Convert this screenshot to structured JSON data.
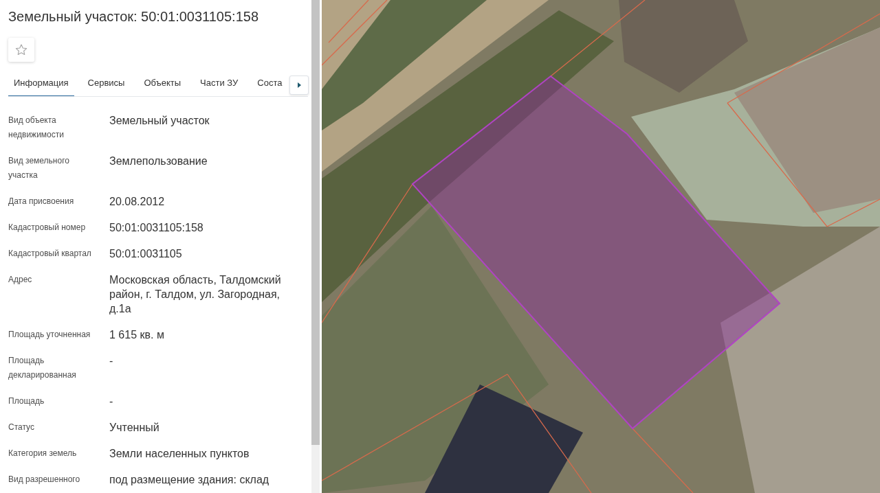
{
  "title": "Земельный участок: 50:01:0031105:158",
  "tabs": [
    {
      "label": "Информация",
      "selected": true
    },
    {
      "label": "Сервисы",
      "selected": false
    },
    {
      "label": "Объекты",
      "selected": false
    },
    {
      "label": "Части ЗУ",
      "selected": false
    },
    {
      "label": "Соста",
      "selected": false
    }
  ],
  "properties": [
    {
      "label": "Вид объекта недвижимости",
      "value": "Земельный участок"
    },
    {
      "label": "Вид земельного участка",
      "value": "Землепользование"
    },
    {
      "label": "Дата присвоения",
      "value": "20.08.2012"
    },
    {
      "label": "Кадастровый номер",
      "value": "50:01:0031105:158"
    },
    {
      "label": "Кадастровый квартал",
      "value": "50:01:0031105"
    },
    {
      "label": "Адрес",
      "value": "Московская область, Талдомский район, г. Талдом, ул. Загородная, д.1а"
    },
    {
      "label": "Площадь уточненная",
      "value": "1 615 кв. м"
    },
    {
      "label": "Площадь декларированная",
      "value": "-"
    },
    {
      "label": "Площадь",
      "value": "-"
    },
    {
      "label": "Статус",
      "value": "Учтенный"
    },
    {
      "label": "Категория земель",
      "value": "Земли населенных пунктов"
    },
    {
      "label": "Вид разрешенного",
      "value": "под размещение здания: склад"
    }
  ]
}
